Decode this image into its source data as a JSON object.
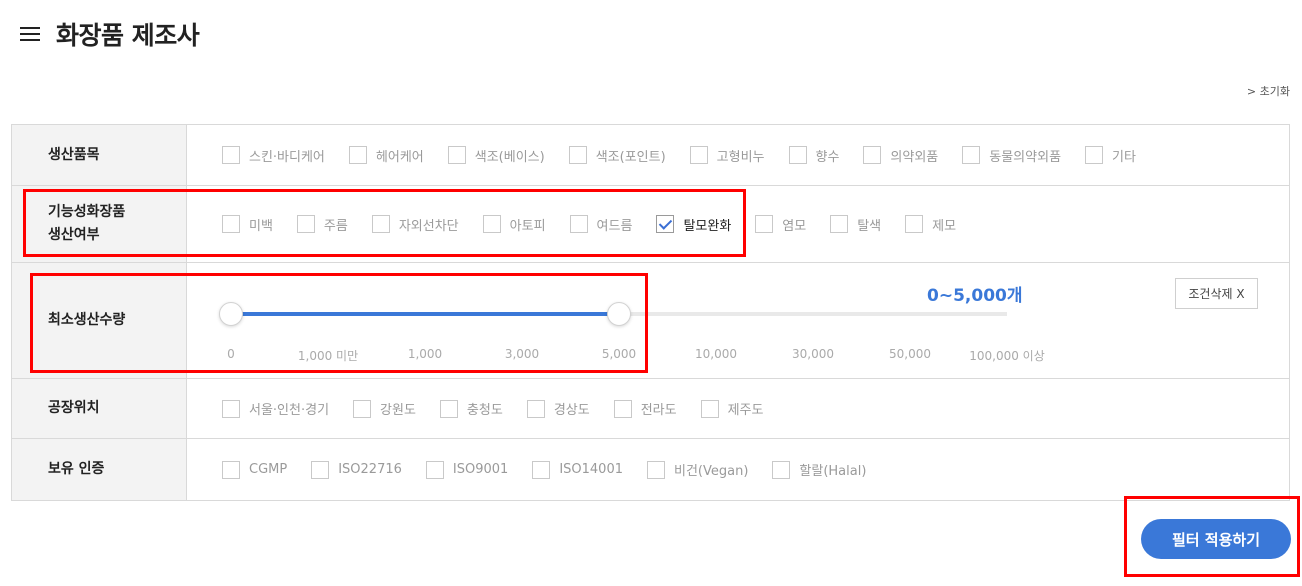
{
  "header": {
    "title": "화장품 제조사",
    "menu_icon": "hamburger-menu-icon"
  },
  "reset_label": "> 초기화",
  "rows": {
    "product_category": {
      "label": "생산품목",
      "options": [
        {
          "label": "스킨·바디케어",
          "checked": false
        },
        {
          "label": "헤어케어",
          "checked": false
        },
        {
          "label": "색조(베이스)",
          "checked": false
        },
        {
          "label": "색조(포인트)",
          "checked": false
        },
        {
          "label": "고형비누",
          "checked": false
        },
        {
          "label": "향수",
          "checked": false
        },
        {
          "label": "의약외품",
          "checked": false
        },
        {
          "label": "동물의약외품",
          "checked": false
        },
        {
          "label": "기타",
          "checked": false
        }
      ]
    },
    "functional": {
      "label_line1": "기능성화장품",
      "label_line2": "생산여부",
      "options": [
        {
          "label": "미백",
          "checked": false
        },
        {
          "label": "주름",
          "checked": false
        },
        {
          "label": "자외선차단",
          "checked": false
        },
        {
          "label": "아토피",
          "checked": false
        },
        {
          "label": "여드름",
          "checked": false
        },
        {
          "label": "탈모완화",
          "checked": true
        },
        {
          "label": "염모",
          "checked": false
        },
        {
          "label": "탈색",
          "checked": false
        },
        {
          "label": "제모",
          "checked": false
        }
      ]
    },
    "min_quantity": {
      "label": "최소생산수량",
      "range_value": "0~5,000개",
      "clear_label": "조건삭제 X",
      "slider_min_fraction": 0.0,
      "slider_max_fraction": 0.5,
      "ticks": [
        "0",
        "1,000 미만",
        "1,000",
        "3,000",
        "5,000",
        "10,000",
        "30,000",
        "50,000",
        "100,000 이상"
      ]
    },
    "location": {
      "label": "공장위치",
      "options": [
        {
          "label": "서울·인천·경기",
          "checked": false
        },
        {
          "label": "강원도",
          "checked": false
        },
        {
          "label": "충청도",
          "checked": false
        },
        {
          "label": "경상도",
          "checked": false
        },
        {
          "label": "전라도",
          "checked": false
        },
        {
          "label": "제주도",
          "checked": false
        }
      ]
    },
    "certification": {
      "label": "보유 인증",
      "options": [
        {
          "label": "CGMP",
          "checked": false
        },
        {
          "label": "ISO22716",
          "checked": false
        },
        {
          "label": "ISO9001",
          "checked": false
        },
        {
          "label": "ISO14001",
          "checked": false
        },
        {
          "label": "비건(Vegan)",
          "checked": false
        },
        {
          "label": "할랄(Halal)",
          "checked": false
        }
      ]
    }
  },
  "apply_label": "필터 적용하기",
  "colors": {
    "accent": "#3a78d8",
    "highlight": "#ff0000"
  }
}
